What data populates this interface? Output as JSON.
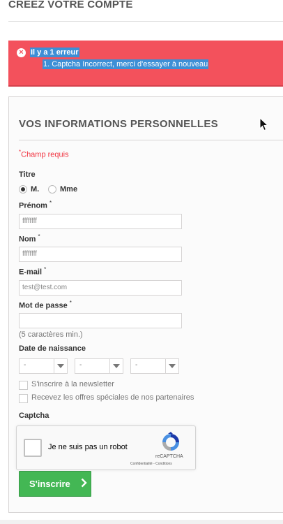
{
  "page": {
    "title": "Créez votre compte"
  },
  "alert": {
    "heading": "Il y a 1 erreur",
    "errors": [
      {
        "number": "1.",
        "text": "Captcha Incorrect, merci d'essayer à nouveau"
      }
    ]
  },
  "form": {
    "section_title": "Vos informations personnelles",
    "required_note": "Champ requis",
    "required_mark": "*",
    "title_label": "Titre",
    "title_options": [
      {
        "label": "M.",
        "selected": true
      },
      {
        "label": "Mme",
        "selected": false
      }
    ],
    "firstname": {
      "label": "Prénom",
      "value": "ffffffff"
    },
    "lastname": {
      "label": "Nom",
      "value": "ffffffff"
    },
    "email": {
      "label": "E-mail",
      "value": "test@test.com"
    },
    "password": {
      "label": "Mot de passe",
      "value": "",
      "hint": "(5 caractères min.)"
    },
    "birthdate": {
      "label": "Date de naissance",
      "day": "-",
      "month": "-",
      "year": "-"
    },
    "newsletter_label": "S'inscrire à la newsletter",
    "optin_label": "Recevez les offres spéciales de nos partenaires",
    "captcha_label": "Captcha",
    "recaptcha": {
      "text": "Je ne suis pas un robot",
      "brand": "reCAPTCHA",
      "links": "Confidentialité - Conditions"
    },
    "submit_label": "S'inscrire"
  },
  "colors": {
    "alert_bg": "#f3515c",
    "submit_bg": "#43b754",
    "required": "#f13340"
  }
}
